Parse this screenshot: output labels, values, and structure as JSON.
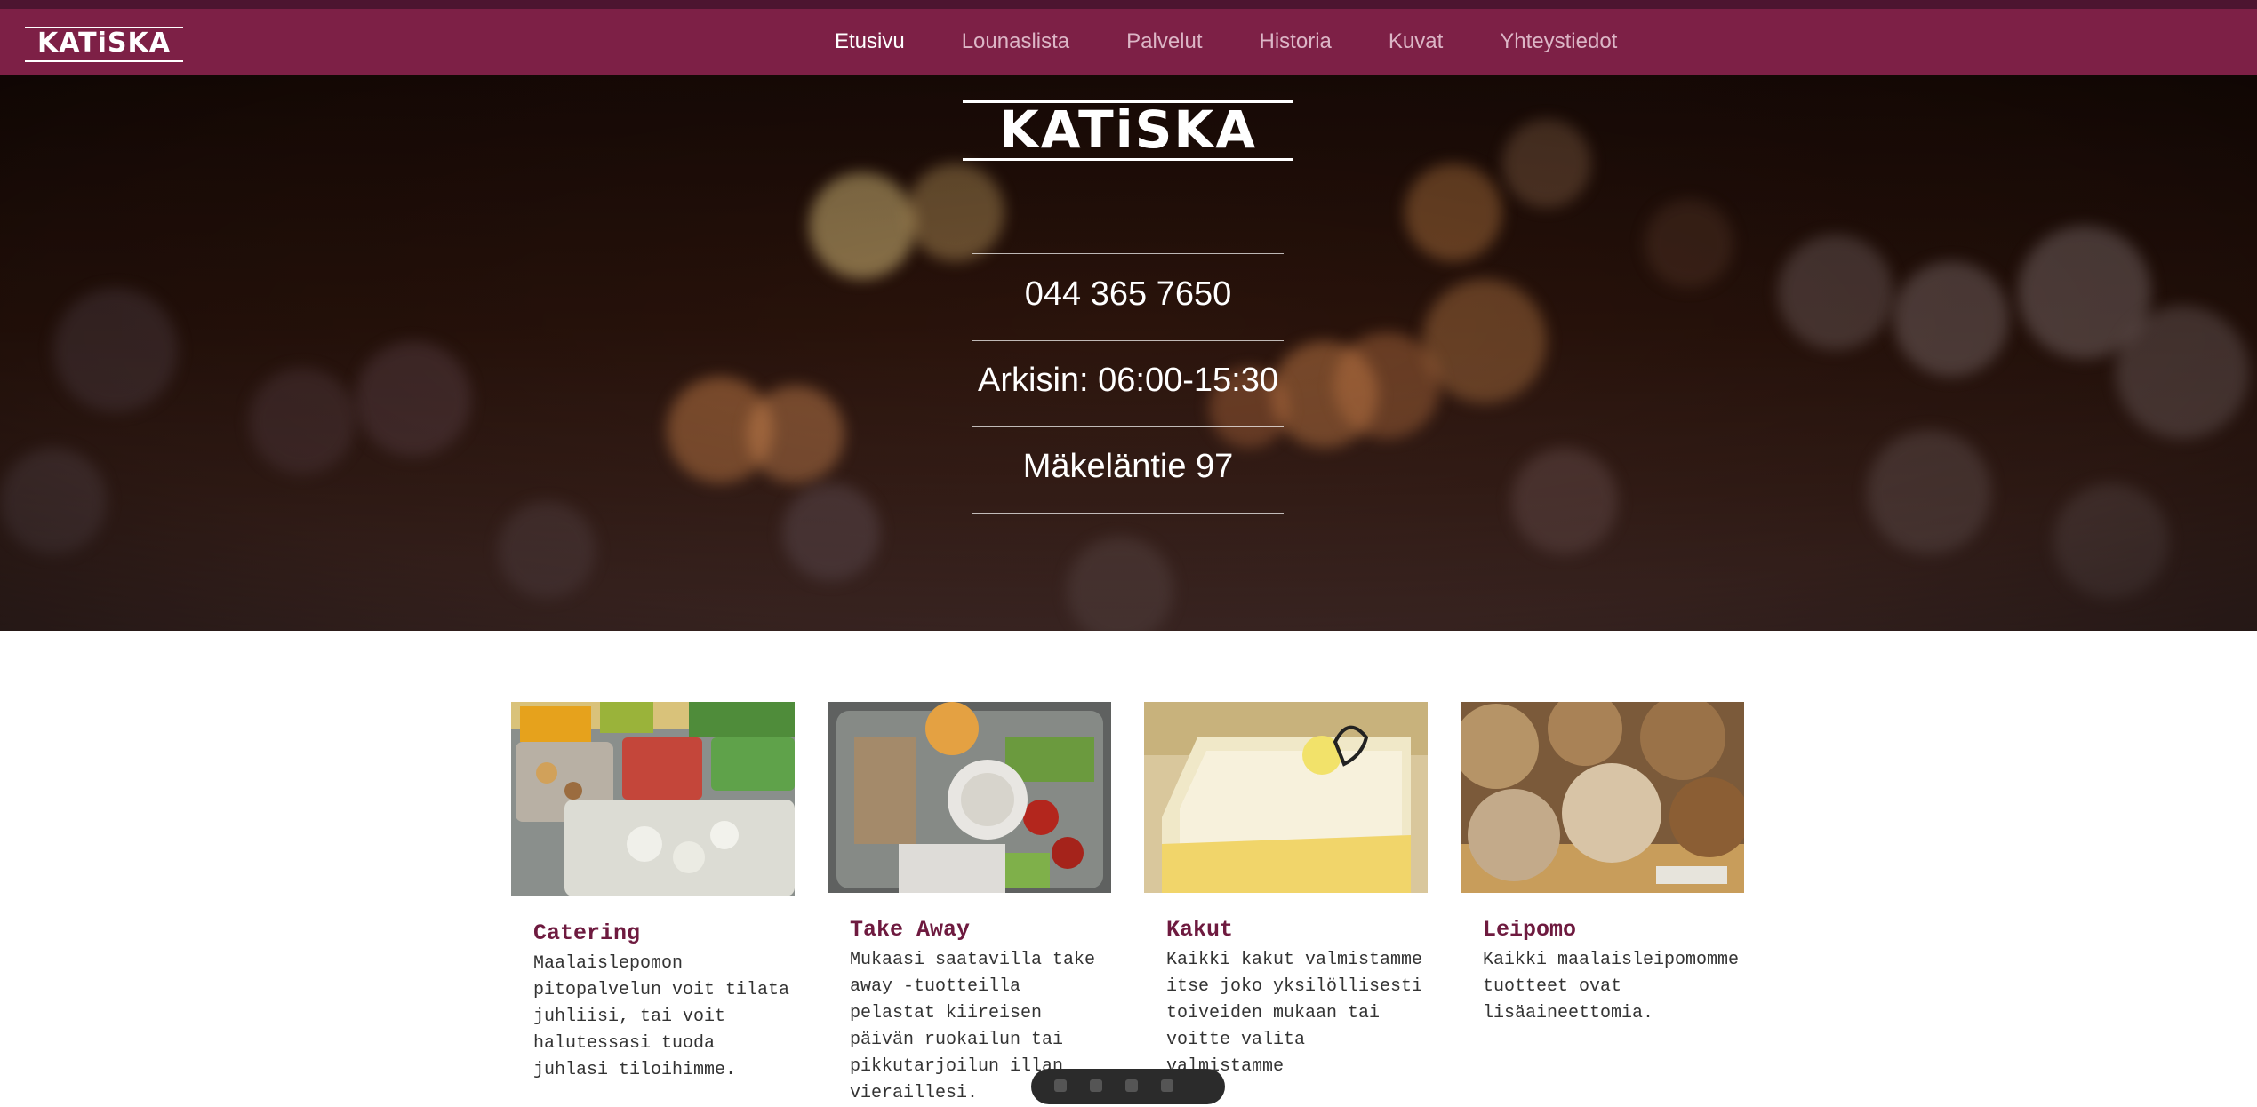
{
  "header": {
    "logo_text": "KATiSKA",
    "nav": [
      {
        "label": "Etusivu",
        "active": true
      },
      {
        "label": "Lounaslista"
      },
      {
        "label": "Palvelut"
      },
      {
        "label": "Historia"
      },
      {
        "label": "Kuvat"
      },
      {
        "label": "Yhteystiedot"
      }
    ]
  },
  "hero": {
    "logo_text": "KATiSKA",
    "phone": "044 365 7650",
    "hours": "Arkisin: 06:00-15:30",
    "address": "Mäkeläntie 97"
  },
  "services": [
    {
      "title": "Catering",
      "text": "Maalaislepomon pitopalvelun voit tilata juhliisi, tai voit halutessasi tuoda juhlasi tiloihimme."
    },
    {
      "title": "Take Away",
      "text": "Mukaasi saatavilla take away -tuotteilla pelastat kiireisen päivän ruokailun tai pikkutarjoilun illan vieraillesi."
    },
    {
      "title": "Kakut",
      "text": "Kaikki kakut valmistamme itse joko yksilöllisesti toiveiden mukaan tai voitte valita valmistamme"
    },
    {
      "title": "Leipomo",
      "text": "Kaikki maalaisleipomomme tuotteet ovat lisäaineettomia."
    }
  ],
  "colors": {
    "brand": "#7d2046",
    "title": "#6e1a3f"
  }
}
